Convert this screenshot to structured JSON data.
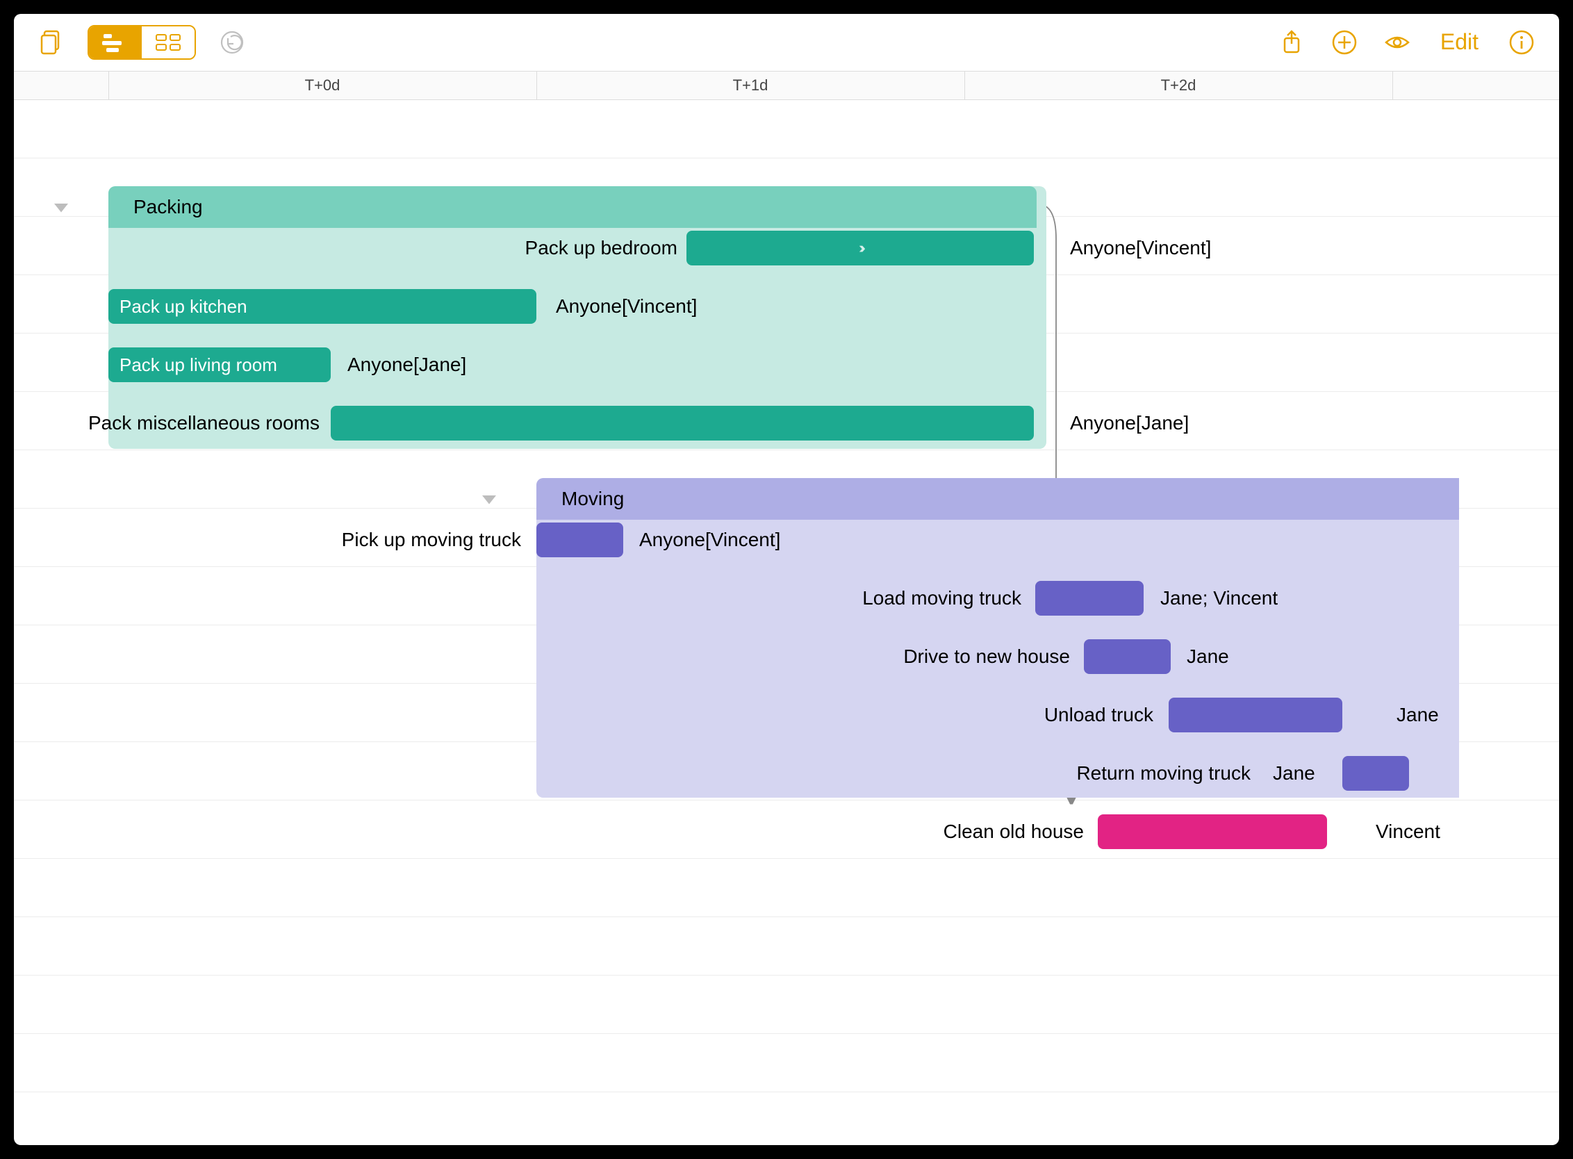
{
  "toolbar": {
    "edit_label": "Edit"
  },
  "time_columns": [
    "T+0d",
    "T+1d",
    "T+2d"
  ],
  "chart_data": {
    "type": "gantt",
    "time_axis": {
      "unit": "days",
      "ticks": [
        0,
        1,
        2
      ]
    },
    "groups": [
      {
        "id": "packing",
        "name": "Packing",
        "color": "teal",
        "start": 0.0,
        "end": 2.0,
        "row": 1
      },
      {
        "id": "moving",
        "name": "Moving",
        "color": "purple",
        "start": 1.0,
        "end": 3.0,
        "row": 6
      }
    ],
    "tasks": [
      {
        "id": "bedroom",
        "group": "packing",
        "row": 2,
        "label": "Pack up bedroom",
        "label_side": "left",
        "start": 1.35,
        "end": 2.0,
        "color": "teal",
        "assignee": "Anyone[Vincent]",
        "assignee_side": "right",
        "chevrons": true
      },
      {
        "id": "kitchen",
        "group": "packing",
        "row": 3,
        "label": "Pack up kitchen",
        "label_inside": true,
        "start": 0.0,
        "end": 1.0,
        "color": "teal",
        "assignee": "Anyone[Vincent]",
        "assignee_side": "right"
      },
      {
        "id": "living",
        "group": "packing",
        "row": 4,
        "label": "Pack up living room",
        "label_inside": true,
        "start": 0.0,
        "end": 0.5,
        "color": "teal",
        "assignee": "Anyone[Jane]",
        "assignee_side": "right"
      },
      {
        "id": "misc",
        "group": "packing",
        "row": 5,
        "label": "Pack miscellaneous rooms",
        "label_side": "left",
        "start": 0.5,
        "end": 2.0,
        "color": "teal",
        "assignee": "Anyone[Jane]",
        "assignee_side": "right"
      },
      {
        "id": "pickup",
        "group": "moving",
        "row": 7,
        "label": "Pick up moving truck",
        "label_side": "left",
        "start": 1.0,
        "end": 1.2,
        "color": "purple",
        "assignee": "Anyone[Vincent]",
        "assignee_side": "right"
      },
      {
        "id": "load",
        "group": "moving",
        "row": 8,
        "label": "Load moving truck",
        "label_side": "left",
        "start": 2.0,
        "end": 2.25,
        "color": "purple",
        "assignee": "Jane; Vincent",
        "assignee_side": "right"
      },
      {
        "id": "drive",
        "group": "moving",
        "row": 9,
        "label": "Drive to new house",
        "label_side": "left",
        "start": 2.25,
        "end": 2.45,
        "color": "purple",
        "assignee": "Jane",
        "assignee_side": "right"
      },
      {
        "id": "unload",
        "group": "moving",
        "row": 10,
        "label": "Unload truck",
        "label_side": "left",
        "start": 2.45,
        "end": 2.85,
        "color": "purple",
        "assignee": "Jane",
        "assignee_side": "right"
      },
      {
        "id": "return",
        "group": "moving",
        "row": 11,
        "label": "Return moving truck",
        "label_side": "left",
        "start": 2.85,
        "end": 3.0,
        "color": "purple",
        "assignee": "Jane",
        "assignee_side": "left-float"
      },
      {
        "id": "clean",
        "group": null,
        "row": 12,
        "label": "Clean old house",
        "label_side": "left",
        "start": 2.25,
        "end": 2.78,
        "color": "pink",
        "assignee": "Vincent",
        "assignee_side": "right"
      }
    ],
    "dependencies": [
      {
        "from": "packing",
        "to": "load"
      },
      {
        "from": "pickup",
        "to": "load"
      },
      {
        "from": "load",
        "to": "drive"
      },
      {
        "from": "load",
        "to": "clean"
      },
      {
        "from": "drive",
        "to": "unload"
      },
      {
        "from": "unload",
        "to": "return"
      }
    ]
  },
  "colors": {
    "accent": "#e8a400",
    "teal_light": "#c6eae2",
    "teal_mid": "#78d0bd",
    "teal_dark": "#1daa90",
    "purple_light": "#d5d5f1",
    "purple_mid": "#aeaee5",
    "purple_dark": "#6761c6",
    "pink": "#e22384"
  }
}
